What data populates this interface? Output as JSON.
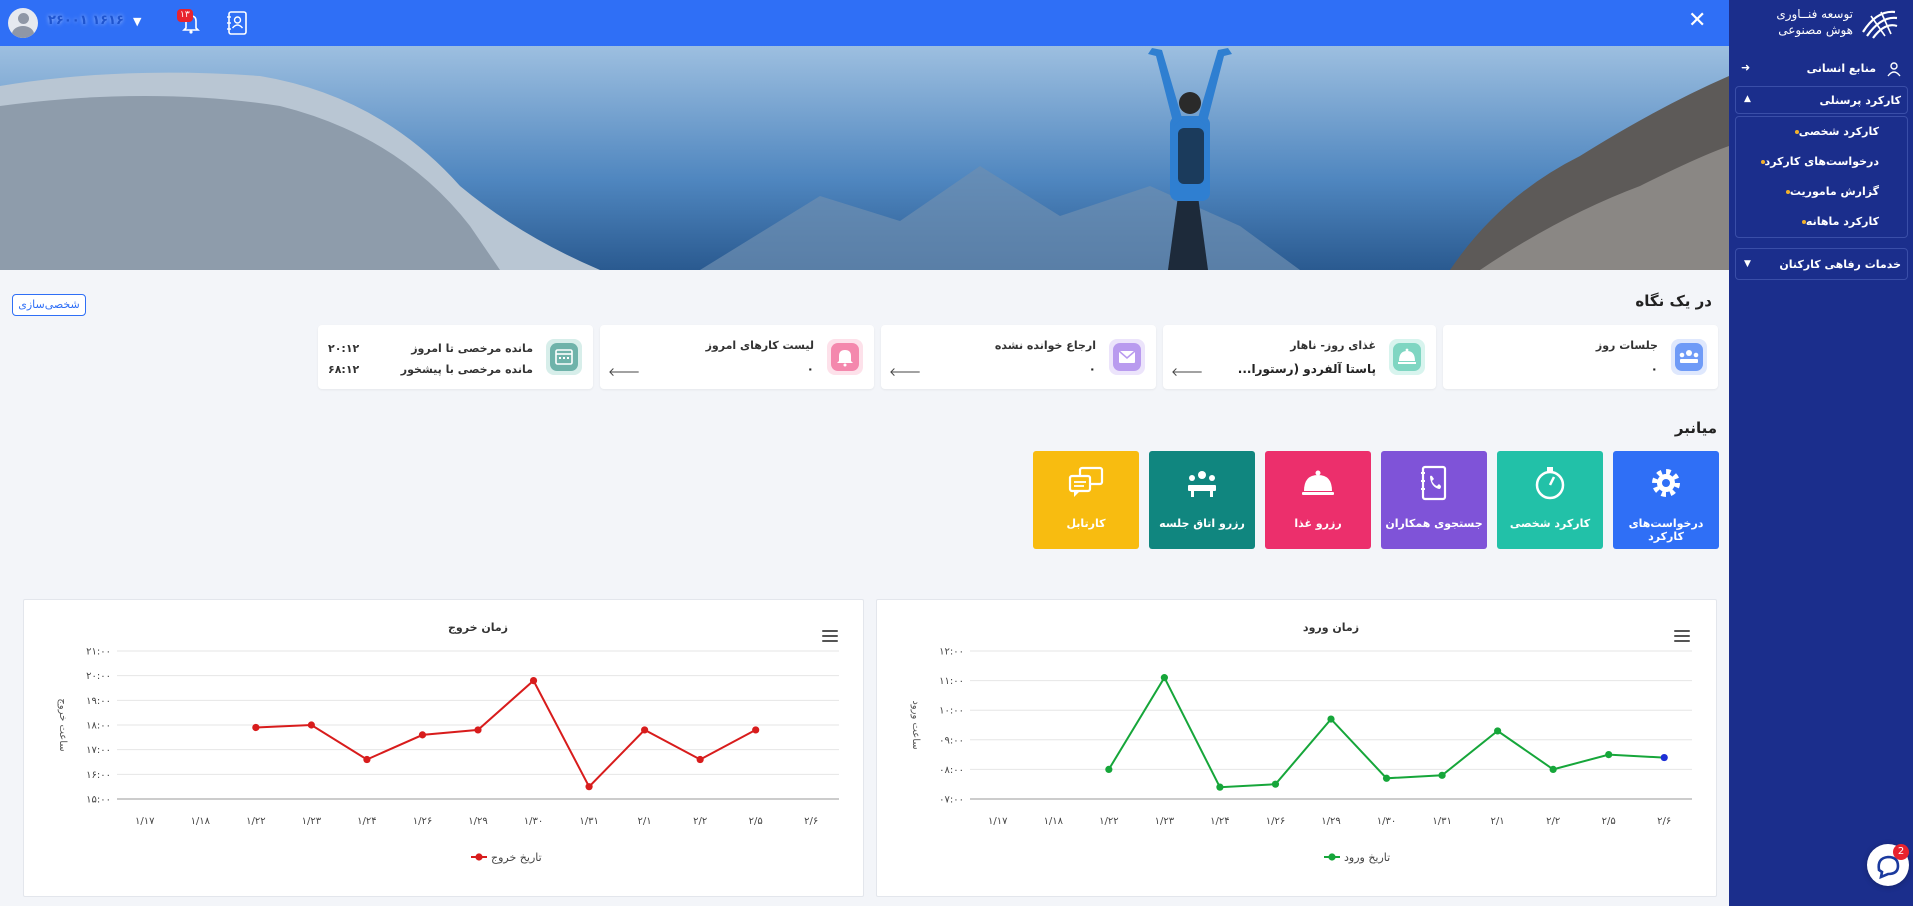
{
  "header": {
    "user_name": "۱۶۱۶ ۲۶۰۰۱",
    "notification_count": "۱۳"
  },
  "brand": {
    "line1": "توسعه فنــاوری",
    "line2": "هوش مصنوعی"
  },
  "sidebar": {
    "hr_label": "منابع انسانی",
    "group_label": "کارکرد پرسنلی",
    "sub_items": [
      "کارکرد شخصی",
      "درخواست‌های کارکرد",
      "گزارش ماموریت",
      "کارکرد ماهانه"
    ],
    "welfare_label": "خدمات رفاهی کارکنان"
  },
  "glance": {
    "title": "در یک نگاه",
    "personalize_label": "شخصی‌سازی",
    "cards": [
      {
        "title": "جلسات روز",
        "value": "۰"
      },
      {
        "title": "غذای روز- ناهار",
        "value": "پاستا آلفردو (رستورا..."
      },
      {
        "title": "ارجاع خوانده نشده",
        "value": "۰"
      },
      {
        "title": "لیست کارهای امروز",
        "value": "۰"
      }
    ],
    "leave": {
      "today_label": "مانده مرخصی تا امروز",
      "today_value": "۲۰:۱۲",
      "advance_label": "مانده مرخصی با پیشخور",
      "advance_value": "۶۸:۱۲"
    }
  },
  "shortcuts": {
    "title": "میانبر",
    "items": [
      {
        "label": "درخواست‌های کارکرد",
        "color": "#2f6ff6"
      },
      {
        "label": "کارکرد شخصی",
        "color": "#22c1a8"
      },
      {
        "label": "جستجوی همکاران",
        "color": "#7f53d8"
      },
      {
        "label": "رزرو غذا",
        "color": "#ec2f6c"
      },
      {
        "label": "رزرو اتاق جلسه",
        "color": "#10867f"
      },
      {
        "label": "کارتابل",
        "color": "#f8bc10"
      }
    ]
  },
  "chart_data": [
    {
      "type": "line",
      "title": "زمان ورود",
      "ylabel": "ساعت ورود",
      "x": [
        "۱/۱۷",
        "۱/۱۸",
        "۱/۲۲",
        "۱/۲۳",
        "۱/۲۴",
        "۱/۲۶",
        "۱/۲۹",
        "۱/۳۰",
        "۱/۳۱",
        "۲/۱",
        "۲/۲",
        "۲/۵",
        "۲/۶"
      ],
      "y_ticks": [
        "۰۷:۰۰",
        "۰۸:۰۰",
        "۰۹:۰۰",
        "۱۰:۰۰",
        "۱۱:۰۰",
        "۱۲:۰۰"
      ],
      "ylim": [
        7,
        12
      ],
      "series": [
        {
          "name": "تاریخ ورود",
          "color": "#16a63a",
          "last_point_color": "#1d2fd6",
          "values": [
            null,
            null,
            8.0,
            11.1,
            7.4,
            7.5,
            9.7,
            7.7,
            7.8,
            9.3,
            8.0,
            8.5,
            8.4
          ]
        }
      ],
      "grid": true,
      "legend": "bottom"
    },
    {
      "type": "line",
      "title": "زمان خروج",
      "ylabel": "ساعت خروج",
      "x": [
        "۱/۱۷",
        "۱/۱۸",
        "۱/۲۲",
        "۱/۲۳",
        "۱/۲۴",
        "۱/۲۶",
        "۱/۲۹",
        "۱/۳۰",
        "۱/۳۱",
        "۲/۱",
        "۲/۲",
        "۲/۵",
        "۲/۶"
      ],
      "y_ticks": [
        "۱۵:۰۰",
        "۱۶:۰۰",
        "۱۷:۰۰",
        "۱۸:۰۰",
        "۱۹:۰۰",
        "۲۰:۰۰",
        "۲۱:۰۰"
      ],
      "ylim": [
        15,
        21
      ],
      "series": [
        {
          "name": "تاریخ خروج",
          "color": "#d81c1c",
          "values": [
            null,
            null,
            17.9,
            18.0,
            16.6,
            17.6,
            17.8,
            19.8,
            15.5,
            17.8,
            16.6,
            17.8,
            null
          ]
        }
      ],
      "grid": true,
      "legend": "bottom"
    }
  ]
}
